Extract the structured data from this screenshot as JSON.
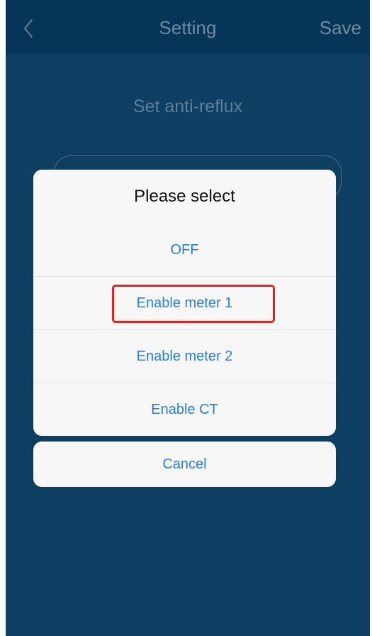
{
  "navbar": {
    "back_icon": "chevron-left-icon",
    "title": "Setting",
    "save_label": "Save"
  },
  "page": {
    "heading": "Set anti-reflux"
  },
  "action_sheet": {
    "title": "Please select",
    "options": [
      {
        "label": "OFF"
      },
      {
        "label": "Enable meter 1",
        "highlighted": true
      },
      {
        "label": "Enable meter 2"
      },
      {
        "label": "Enable CT"
      }
    ],
    "cancel_label": "Cancel"
  },
  "colors": {
    "background": "#0e3e62",
    "navbar": "#063557",
    "option_text": "#2a7fd4",
    "highlight_border": "#e8221b"
  }
}
